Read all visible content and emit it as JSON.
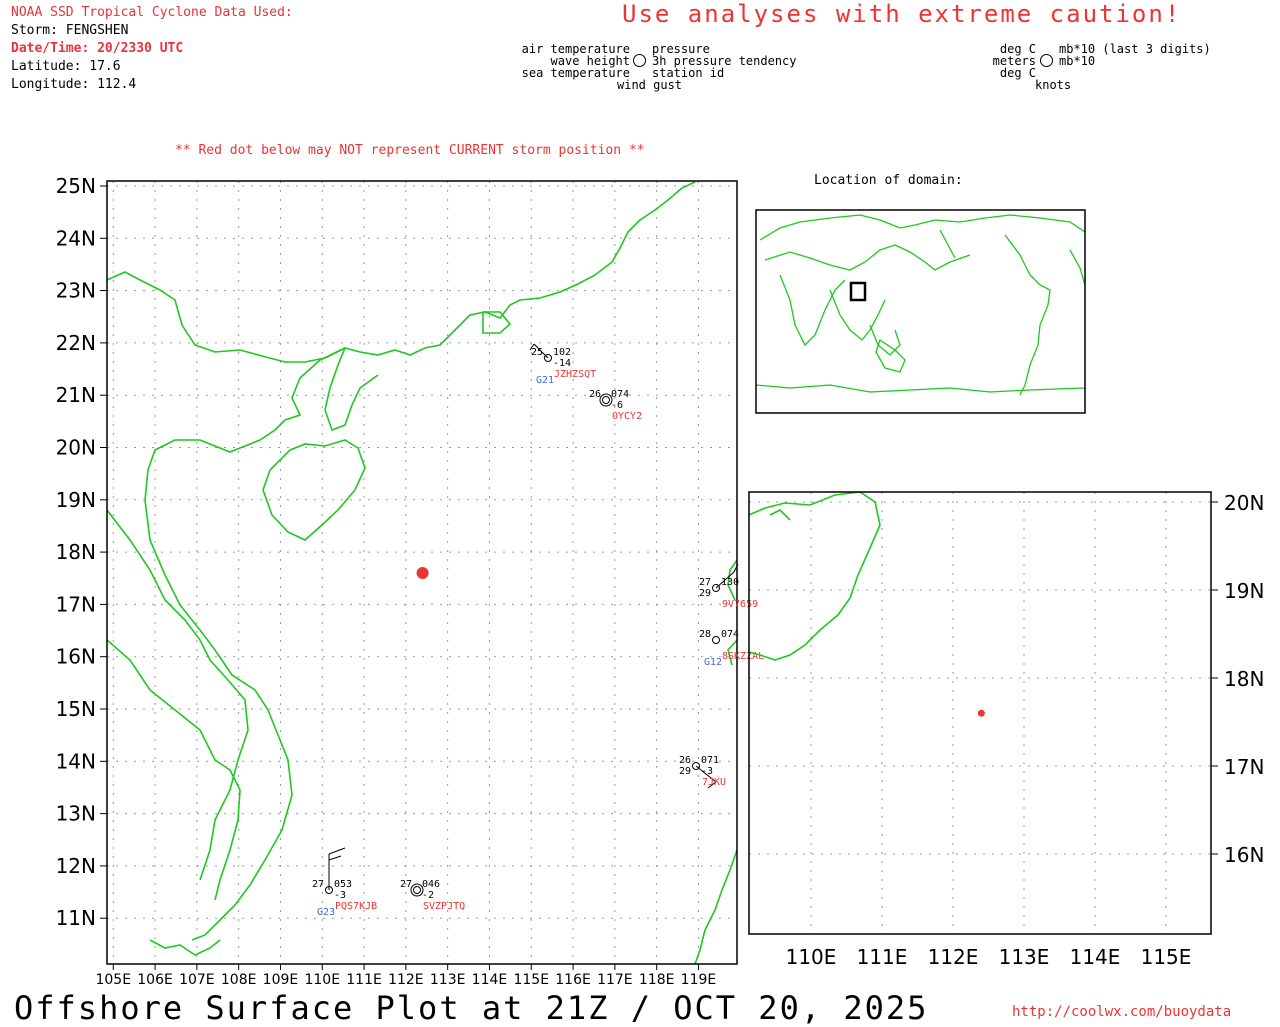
{
  "header": {
    "source": "NOAA SSD Tropical Cyclone Data Used:",
    "storm": "Storm: FENGSHEN",
    "datetime": "Date/Time: 20/2330 UTC",
    "latitude": "Latitude: 17.6",
    "longitude": "Longitude: 112.4"
  },
  "caution": "Use analyses with extreme caution!",
  "legend": {
    "left": [
      "air temperature",
      "wave height",
      "sea temperature"
    ],
    "right": [
      "pressure",
      "3h pressure tendency",
      "station id"
    ],
    "bottom": "wind gust",
    "units_left": [
      "deg C",
      "meters",
      "deg C"
    ],
    "units_right": [
      "mb*10 (last 3 digits)",
      "mb*10"
    ],
    "units_bottom": "knots"
  },
  "warning": "** Red dot below may NOT represent CURRENT storm position **",
  "inset_title": "Location of domain:",
  "main_map": {
    "lat_labels": [
      "25N",
      "24N",
      "23N",
      "22N",
      "21N",
      "20N",
      "19N",
      "18N",
      "17N",
      "16N",
      "15N",
      "14N",
      "13N",
      "12N",
      "11N"
    ],
    "lon_labels": [
      "105E",
      "106E",
      "107E",
      "108E",
      "109E",
      "110E",
      "111E",
      "112E",
      "113E",
      "114E",
      "115E",
      "116E",
      "117E",
      "118E",
      "119E"
    ]
  },
  "zoom_map": {
    "lat_labels": [
      "20N",
      "19N",
      "18N",
      "17N",
      "16N"
    ],
    "lon_labels": [
      "110E",
      "111E",
      "112E",
      "113E",
      "114E",
      "115E"
    ]
  },
  "storm_position": {
    "lat": 17.6,
    "lon": 112.4,
    "color": "#ee3333"
  },
  "stations": [
    {
      "id": "JZHZSQT",
      "air": "25",
      "pressure": "102",
      "tendency": "-14",
      "group": "G21"
    },
    {
      "id": "OYCY2",
      "air": "26",
      "pressure": "074",
      "tendency": "-6",
      "group": ""
    },
    {
      "id": "9V7659",
      "air": "27",
      "pressure": "130",
      "sea": "29",
      "group": ""
    },
    {
      "id": "8SKZZAL",
      "air": "28",
      "pressure": "074",
      "group": "G12"
    },
    {
      "id": "7JKU",
      "air": "26",
      "pressure": "071",
      "sea": "29",
      "tendency": "-3",
      "group": ""
    },
    {
      "id": "PQS7KJB",
      "air": "27",
      "pressure": "053",
      "tendency": "-3",
      "group": "G23"
    },
    {
      "id": "SVZPJTQ",
      "air": "27",
      "pressure": "046",
      "tendency": "-2",
      "group": ""
    }
  ],
  "footer": {
    "title": "Offshore Surface Plot at 21Z / OCT 20, 2025",
    "url": "http://coolwx.com/buoydata"
  },
  "colors": {
    "coast": "#1ec81e",
    "accent": "#ee3333",
    "group": "#4466dd"
  }
}
